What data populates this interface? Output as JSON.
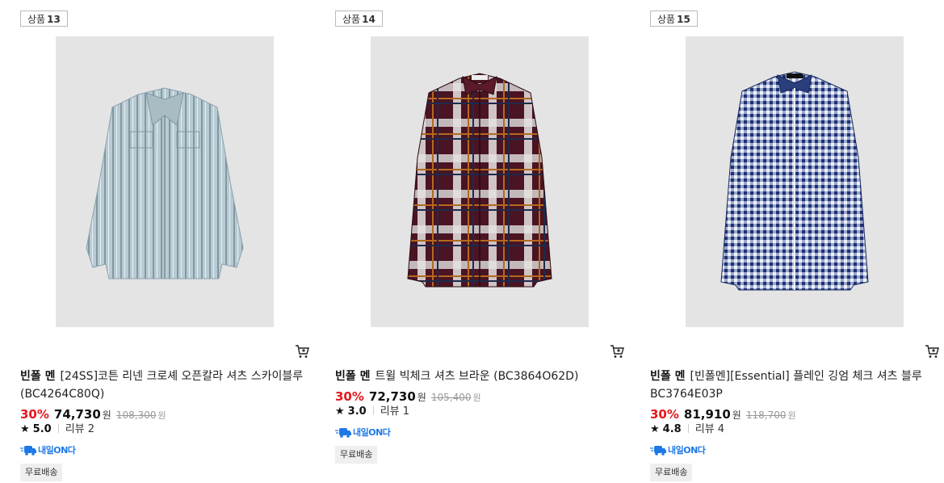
{
  "products": [
    {
      "badge_prefix": "상품",
      "badge_num": "13",
      "image": "blue-gray-striped-open-collar-shirt",
      "brand": "빈폴 멘",
      "name": "[24SS]코튼 리넨 크로셰 오픈칼라 셔츠 스카이블루 (BC4264C80Q)",
      "discount": "30%",
      "price": "74,730",
      "price_unit": "원",
      "original_price": "108,300",
      "original_unit": "원",
      "rating": "5.0",
      "reviews": "리뷰 2",
      "delivery": "내일ON다",
      "shipping": "무료배송"
    },
    {
      "badge_prefix": "상품",
      "badge_num": "14",
      "image": "burgundy-plaid-check-shirt",
      "brand": "빈폴 멘",
      "name": "트윌 빅체크 셔츠 브라운 (BC3864O62D)",
      "discount": "30%",
      "price": "72,730",
      "price_unit": "원",
      "original_price": "105,400",
      "original_unit": "원",
      "rating": "3.0",
      "reviews": "리뷰 1",
      "delivery": "내일ON다",
      "shipping": "무료배송"
    },
    {
      "badge_prefix": "상품",
      "badge_num": "15",
      "image": "navy-gingham-check-shirt",
      "brand": "빈폴 멘",
      "name": "[빈폴멘][Essential] 플레인 깅엄 체크 셔츠 블루 BC3764E03P",
      "discount": "30%",
      "price": "81,910",
      "price_unit": "원",
      "original_price": "118,700",
      "original_unit": "원",
      "rating": "4.8",
      "reviews": "리뷰 4",
      "delivery": "내일ON다",
      "shipping": "무료배송"
    }
  ],
  "icons": {
    "cart": "cart-icon",
    "star": "star-icon",
    "delivery": "delivery-truck-icon"
  },
  "colors": {
    "discount": "#e4171d",
    "delivery": "#1e78e6",
    "image_bg": "#e4e4e4"
  }
}
